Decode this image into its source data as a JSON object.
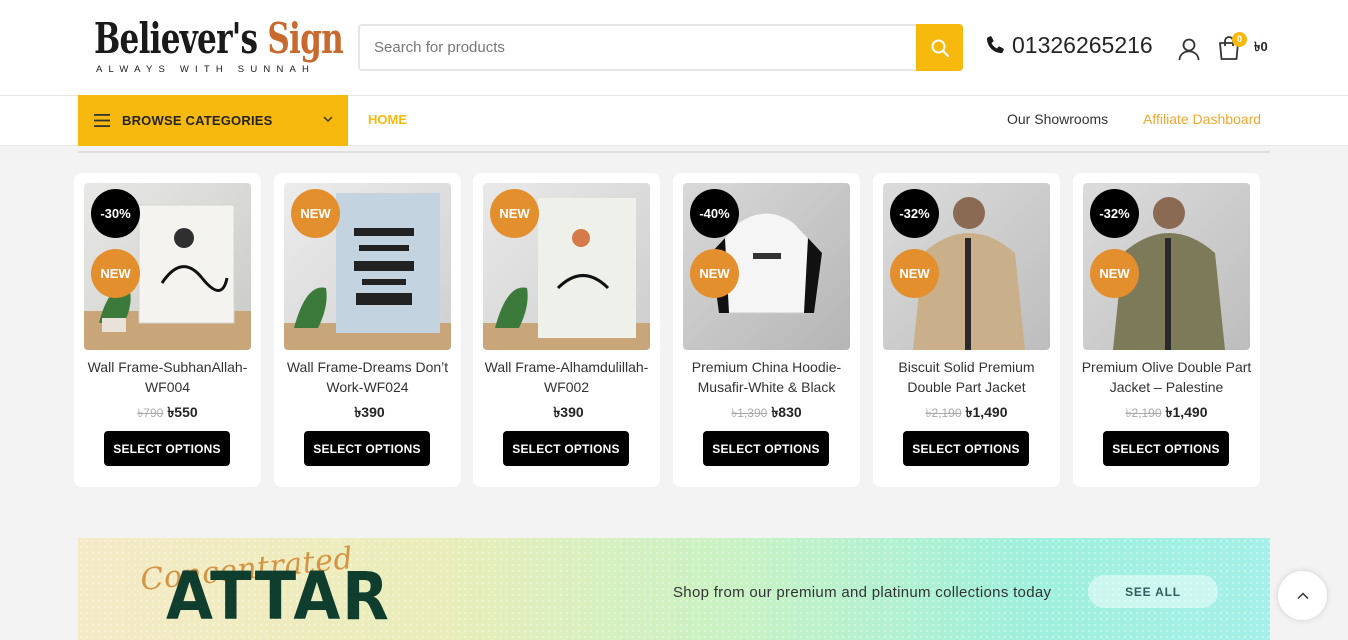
{
  "header": {
    "logo_main_a": "Believer's",
    "logo_main_b": "Sign",
    "logo_sub": "ALWAYS WITH SUNNAH",
    "search_placeholder": "Search for products",
    "phone": "01326265216",
    "cart_count": "0",
    "cart_total": "৳0",
    "accent_color": "#f7b90d"
  },
  "nav": {
    "browse_label": "BROWSE CATEGORIES",
    "home": "HOME",
    "showrooms": "Our Showrooms",
    "affiliate": "Affiliate Dashboard"
  },
  "products": [
    {
      "title": "Wall Frame-SubhanAllah-WF004",
      "old_price": "৳790",
      "price": "৳550",
      "sale_badge": "-30%",
      "new_badge": "NEW",
      "button": "SELECT OPTIONS",
      "image_icon": "wall-frame-image"
    },
    {
      "title": "Wall Frame-Dreams Don’t Work-WF024",
      "old_price": "",
      "price": "৳390",
      "sale_badge": "",
      "new_badge": "NEW",
      "button": "SELECT OPTIONS",
      "image_icon": "wall-frame-image"
    },
    {
      "title": "Wall Frame-Alhamdulillah-WF002",
      "old_price": "",
      "price": "৳390",
      "sale_badge": "",
      "new_badge": "NEW",
      "button": "SELECT OPTIONS",
      "image_icon": "wall-frame-image"
    },
    {
      "title": "Premium China Hoodie-Musafir-White & Black",
      "old_price": "৳1,390",
      "price": "৳830",
      "sale_badge": "-40%",
      "new_badge": "NEW",
      "button": "SELECT OPTIONS",
      "image_icon": "hoodie-image"
    },
    {
      "title": "Biscuit Solid Premium Double Part Jacket",
      "old_price": "৳2,190",
      "price": "৳1,490",
      "sale_badge": "-32%",
      "new_badge": "NEW",
      "button": "SELECT OPTIONS",
      "image_icon": "jacket-image"
    },
    {
      "title": "Premium Olive Double Part Jacket – Palestine",
      "old_price": "৳2,190",
      "price": "৳1,490",
      "sale_badge": "-32%",
      "new_badge": "NEW",
      "button": "SELECT OPTIONS",
      "image_icon": "jacket-image"
    }
  ],
  "banner": {
    "script_text": "Concentrated",
    "big_text": "ATTAR",
    "tagline": "Shop from our premium and platinum collections today",
    "button": "SEE ALL"
  }
}
